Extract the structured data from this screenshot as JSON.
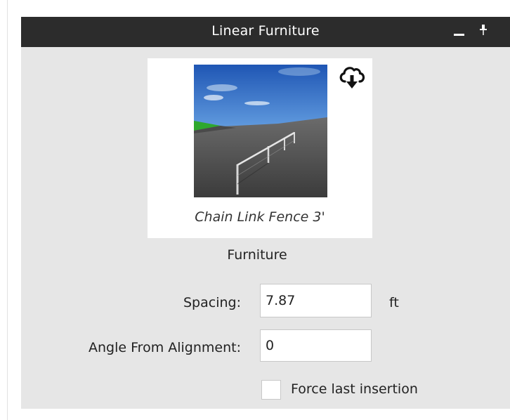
{
  "panel": {
    "title": "Linear Furniture",
    "minimize_icon": "minimize-icon",
    "pin_icon": "pin-icon"
  },
  "item": {
    "name": "Chain Link Fence 3'",
    "thumbnail_icon": "fence-thumbnail",
    "download_icon": "cloud-download-icon"
  },
  "category": "Furniture",
  "spacing": {
    "label": "Spacing:",
    "value": "7.87",
    "unit": "ft"
  },
  "angle": {
    "label": "Angle From Alignment:",
    "value": "0"
  },
  "force_last": {
    "label": "Force last insertion",
    "checked": false
  },
  "colors": {
    "titlebar": "#2c2c2c",
    "panel_bg": "#e6e6e6",
    "card_bg": "#ffffff"
  }
}
